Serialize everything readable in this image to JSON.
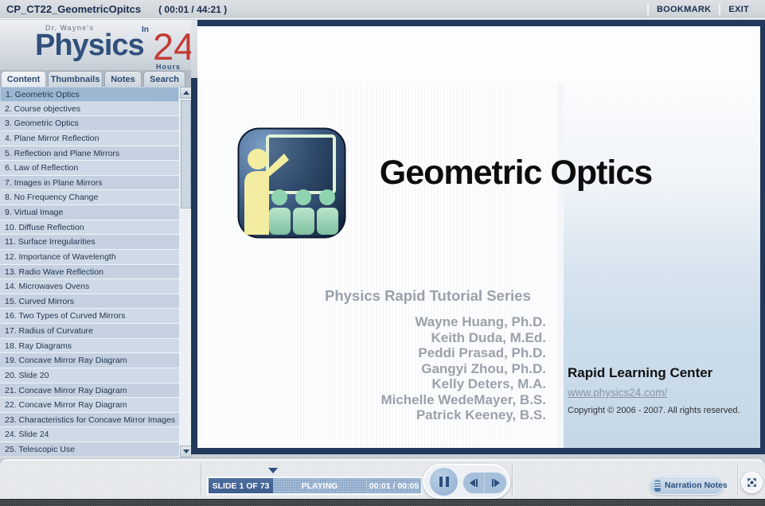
{
  "top_bar": {
    "title": "CP_CT22_GeometricOpitcs",
    "elapsed_total": "( 00:01 / 44:21 )",
    "bookmark_label": "BOOKMARK",
    "exit_label": "EXIT"
  },
  "logo": {
    "pre": "Dr. Wayne's",
    "word": "Physics",
    "in": "In",
    "number": "24",
    "hours": "Hours"
  },
  "sidebar": {
    "tabs": [
      {
        "label": "Content",
        "active": true
      },
      {
        "label": "Thumbnails",
        "active": false
      },
      {
        "label": "Notes",
        "active": false
      },
      {
        "label": "Search",
        "active": false
      }
    ],
    "toc": [
      {
        "label": "1. Geometric Optics",
        "selected": true
      },
      {
        "label": "2. Course objectives",
        "selected": false
      },
      {
        "label": "3. Geometric Optics",
        "selected": false
      },
      {
        "label": "4. Plane Mirror Reflection",
        "selected": false
      },
      {
        "label": "5. Reflection and Plane Mirrors",
        "selected": false
      },
      {
        "label": "6. Law of Reflection",
        "selected": false
      },
      {
        "label": "7. Images in Plane Mirrors",
        "selected": false
      },
      {
        "label": "8. No Frequency Change",
        "selected": false
      },
      {
        "label": "9. Virtual Image",
        "selected": false
      },
      {
        "label": "10. Diffuse Reflection",
        "selected": false
      },
      {
        "label": "11. Surface Irregularities",
        "selected": false
      },
      {
        "label": "12. Importance of Wavelength",
        "selected": false
      },
      {
        "label": "13. Radio Wave Reflection",
        "selected": false
      },
      {
        "label": "14. Microwaves Ovens",
        "selected": false
      },
      {
        "label": "15. Curved Mirrors",
        "selected": false
      },
      {
        "label": "16. Two Types of Curved Mirrors",
        "selected": false
      },
      {
        "label": "17. Radius of Curvature",
        "selected": false
      },
      {
        "label": "18. Ray Diagrams",
        "selected": false
      },
      {
        "label": "19. Concave Mirror Ray Diagram",
        "selected": false
      },
      {
        "label": "20. Slide 20",
        "selected": false
      },
      {
        "label": "21. Concave Mirror Ray Diagram",
        "selected": false
      },
      {
        "label": "22. Concave Mirror Ray Diagram",
        "selected": false
      },
      {
        "label": "23. Characteristics for Concave Mirror Images",
        "selected": false
      },
      {
        "label": "24. Slide 24",
        "selected": false
      },
      {
        "label": "25. Telescopic Use",
        "selected": false
      }
    ]
  },
  "slide": {
    "title": "Geometric Optics",
    "series": "Physics Rapid Tutorial Series",
    "authors": [
      "Wayne Huang, Ph.D.",
      "Keith Duda, M.Ed.",
      "Peddi Prasad, Ph.D.",
      "Gangyi Zhou, Ph.D.",
      "Kelly Deters, M.A.",
      "Michelle WedeMayer, B.S.",
      "Patrick Keeney, B.S."
    ],
    "org": "Rapid Learning Center",
    "url": "www.physics24.com/",
    "copyright": "Copyright © 2006 - 2007. All rights reserved."
  },
  "player": {
    "slide_label": "SLIDE 1 OF 73",
    "status": "PLAYING",
    "time": "00:01 / 00:05",
    "narration_notes_label": "Narration Notes"
  },
  "icons": {
    "presenter": "teacher-at-whiteboard-with-audience",
    "scroll_up": "triangle-up",
    "scroll_down": "triangle-down",
    "playhead": "triangle-down",
    "pause": "pause-bars",
    "previous": "step-backward",
    "next": "step-forward",
    "narration": "document-lines",
    "fullscreen": "expand-arrows"
  },
  "colors": {
    "frame_navy": "#22395c",
    "logo_navy": "#30507c",
    "logo_red": "#c33b33",
    "toc_selected": "#9db7d2",
    "panel_blue": "#c6d8e8",
    "player_box_navy": "#44669c",
    "player_box_blue": "#8ca8ca",
    "muted_gray_text": "#99a1ab"
  }
}
